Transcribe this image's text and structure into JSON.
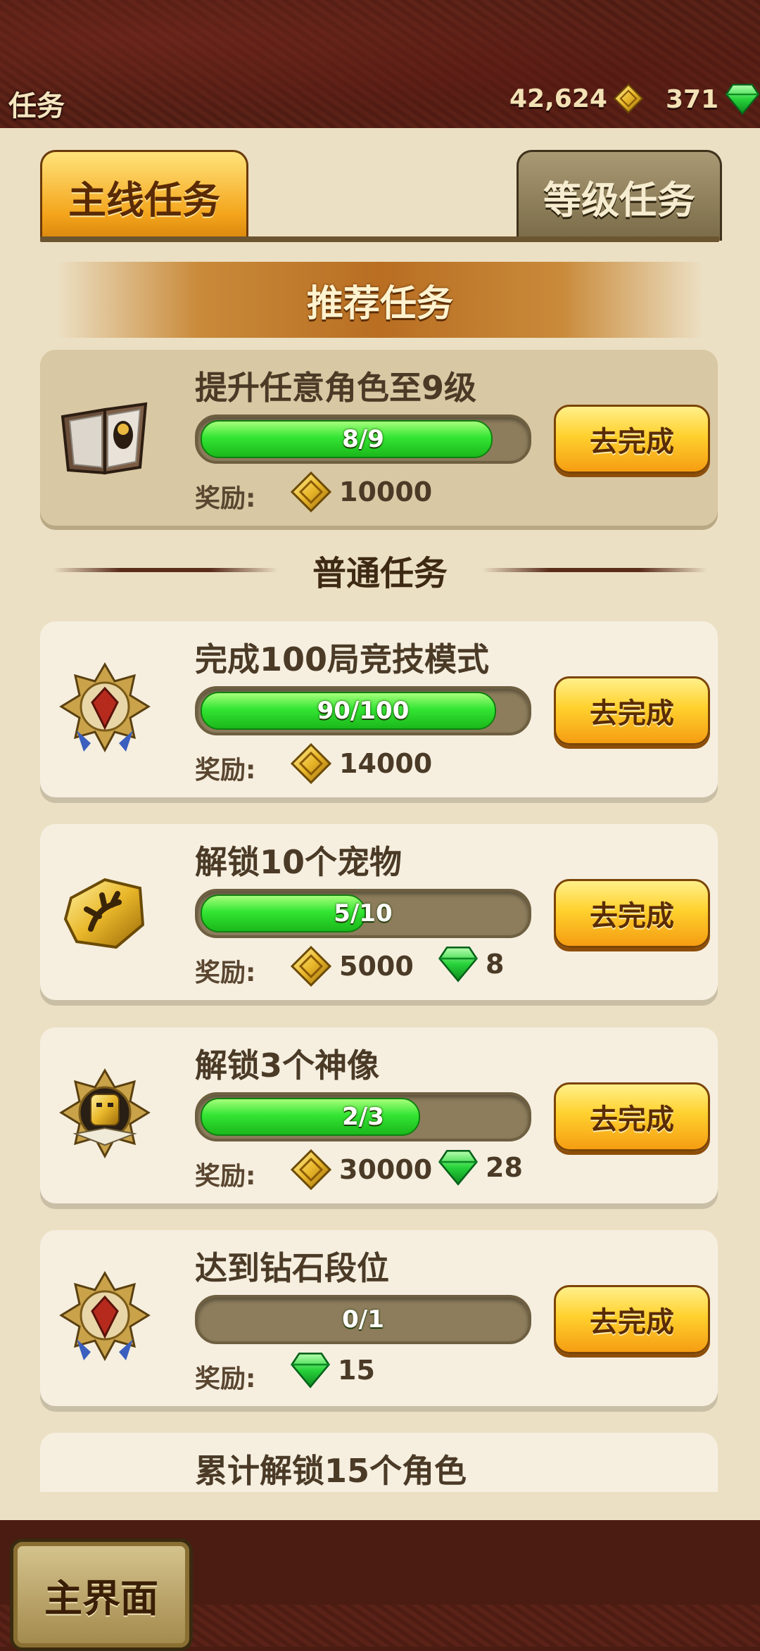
{
  "header": {
    "title": "任务",
    "gold": "42,624",
    "gems": "371"
  },
  "tabs": [
    {
      "label": "主线任务"
    },
    {
      "label": "等级任务"
    }
  ],
  "recommended": {
    "section_title": "推荐任务",
    "task": {
      "name": "提升任意角色至9级",
      "progress_text": "8/9",
      "progress": 0.889,
      "reward_label": "奖励:",
      "reward_gold": "10000",
      "button": "去完成"
    }
  },
  "normal": {
    "section_title": "普通任务",
    "tasks": [
      {
        "name": "完成100局竞技模式",
        "progress_text": "90/100",
        "progress": 0.9,
        "reward_label": "奖励:",
        "reward_gold": "14000",
        "button": "去完成"
      },
      {
        "name": "解锁10个宠物",
        "progress_text": "5/10",
        "progress": 0.5,
        "reward_label": "奖励:",
        "reward_gold": "5000",
        "reward_gems": "8",
        "button": "去完成"
      },
      {
        "name": "解锁3个神像",
        "progress_text": "2/3",
        "progress": 0.667,
        "reward_label": "奖励:",
        "reward_gold": "30000",
        "reward_gems": "28",
        "button": "去完成"
      },
      {
        "name": "达到钻石段位",
        "progress_text": "0/1",
        "progress": 0,
        "reward_label": "奖励:",
        "reward_gems": "15",
        "button": "去完成"
      },
      {
        "name": "累计解锁15个角色"
      }
    ]
  },
  "footer": {
    "home_button": "主界面"
  },
  "colors": {
    "accent_gold": "#f5a51c",
    "progress_green": "#33e533",
    "parchment": "#ece0c4"
  }
}
